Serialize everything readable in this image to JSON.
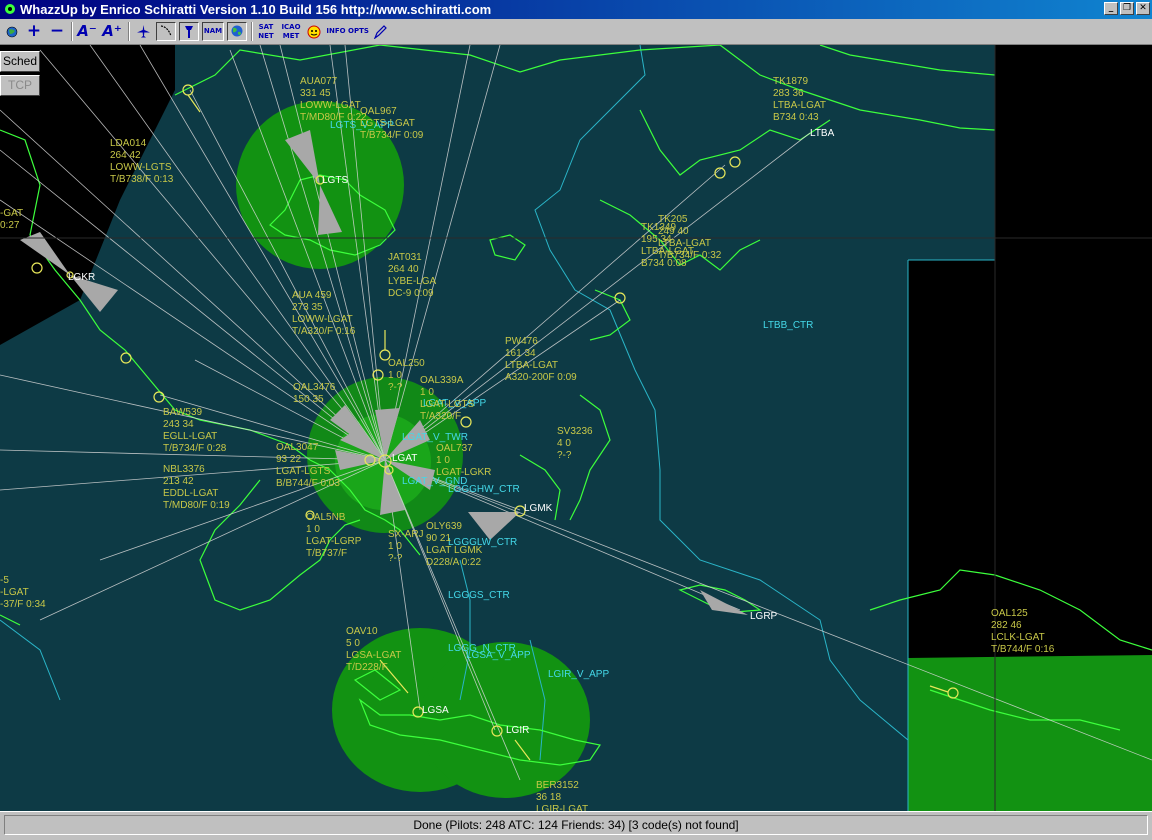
{
  "window": {
    "title": "WhazzUp by Enrico Schiratti Version 1.10 Build 156 http://www.schiratti.com"
  },
  "toolbar": {
    "buttons": [
      {
        "name": "globe-icon",
        "label": ""
      },
      {
        "name": "zoom-in-icon",
        "label": "+"
      },
      {
        "name": "zoom-out-icon",
        "label": "−"
      },
      {
        "name": "font-smaller-icon",
        "label": "A⁻"
      },
      {
        "name": "font-larger-icon",
        "label": "A⁺"
      },
      {
        "name": "aircraft-icon",
        "label": ""
      },
      {
        "name": "route-icon",
        "label": ""
      },
      {
        "name": "tower-icon",
        "label": ""
      },
      {
        "name": "nam-button",
        "label": "NAM"
      },
      {
        "name": "world-icon",
        "label": ""
      },
      {
        "name": "sat-net-button",
        "label": "SAT NET"
      },
      {
        "name": "icao-met-button",
        "label": "ICAO MET"
      },
      {
        "name": "friends-icon",
        "label": ""
      },
      {
        "name": "info-button",
        "label": "INFO"
      },
      {
        "name": "opts-button",
        "label": "OPTS"
      },
      {
        "name": "pen-icon",
        "label": ""
      }
    ]
  },
  "sidebar": {
    "sched": "Sched",
    "tcp": "TCP"
  },
  "map": {
    "colors": {
      "sea": "#0d3a45",
      "land_outside": "#000000",
      "coast": "#3cff3c",
      "fir": "#2ab5c8",
      "coverage": "#129212",
      "label_flight": "#c8c848",
      "label_atc": "#44d8e8",
      "label_airport": "#ffffff",
      "cone": "#a8a8a8"
    },
    "airports": [
      "LGTS",
      "LGKR",
      "LTBA",
      "LGAT",
      "LGMK",
      "LGRP",
      "LGSA",
      "LGIR"
    ],
    "atc_labels": [
      "LGTS_V_APP",
      "LTBB_CTR",
      "LGAT_V_APP",
      "LGAT_V_TWR",
      "LGAT_V_GND",
      "LGGGHW_CTR",
      "LGGGLW_CTR",
      "LGGGS_CTR",
      "LGGG_N_CTR",
      "LGSA_V_APP",
      "LGIR_V_APP"
    ],
    "flights": [
      {
        "lines": [
          "AUA077",
          "331 45",
          "LOWW-LGAT",
          "T/MD80/F 0:22"
        ]
      },
      {
        "lines": [
          "OAL967",
          "LGTS-LGAT",
          "T/B734/F 0:09"
        ]
      },
      {
        "lines": [
          "LDA014",
          "264 42",
          "LOWW-LGTS",
          "T/B738/F 0:13"
        ]
      },
      {
        "lines": [
          "TK1879",
          "283 36",
          "LTBA-LGAT",
          "B734 0:43"
        ]
      },
      {
        "lines": [
          "TK205",
          "249 40",
          "LTBA-LGAT",
          "T/B734/F 0:32"
        ]
      },
      {
        "lines": [
          "TK1349",
          "195 34",
          "LTBA-LGAT",
          "B734 0:08"
        ]
      },
      {
        "lines": [
          "JAT031",
          "264 40",
          "LYBE-LGA",
          "DC-9 0:09"
        ]
      },
      {
        "lines": [
          "AUA 459",
          "273 35",
          "LOWW-LGAT",
          "T/A320/F 0:16"
        ]
      },
      {
        "lines": [
          "OAL250",
          "1 0",
          "?-?"
        ]
      },
      {
        "lines": [
          "PW476",
          "161 34",
          "LTBA-LGAT",
          "A320-200F 0:09"
        ]
      },
      {
        "lines": [
          "OAL339A",
          "1 0",
          "LGAT-LGTS",
          "T/A320/F"
        ]
      },
      {
        "lines": [
          "OAL737",
          "1 0",
          "LGAT-LGKR"
        ]
      },
      {
        "lines": [
          "BAW539",
          "243 34",
          "EGLL-LGAT",
          "T/B734/F 0:28"
        ]
      },
      {
        "lines": [
          "OAL3476",
          "150 35"
        ]
      },
      {
        "lines": [
          "SV3236",
          "4 0",
          "?-?"
        ]
      },
      {
        "lines": [
          "OAL3047",
          "93 22",
          "LGAT-LGTS",
          "B/B744/F 0:03"
        ]
      },
      {
        "lines": [
          "NBL3376",
          "213 42",
          "EDDL-LGAT",
          "T/MD80/F 0:19"
        ]
      },
      {
        "lines": [
          "OLY639",
          "90 21",
          "LGAT LGMK",
          "D228/A 0:22"
        ]
      },
      {
        "lines": [
          "SX-ARJ",
          "1 0",
          "?-?"
        ]
      },
      {
        "lines": [
          "OAL5NB",
          "1 0",
          "LGAT-LGRP",
          "T/B737/F"
        ]
      },
      {
        "lines": [
          "OAV10",
          "5 0",
          "LGSA-LGAT",
          "T/D228/F"
        ]
      },
      {
        "lines": [
          "OAL125",
          "282 46",
          "LCLK-LGAT",
          "T/B744/F 0:16"
        ]
      },
      {
        "lines": [
          "BER3152",
          "36 18",
          "LGIR-LGAT"
        ]
      },
      {
        "lines": [
          "-GAT",
          "0:27"
        ]
      },
      {
        "lines": [
          "-5",
          "-LGAT",
          "-37/F 0:34"
        ]
      }
    ]
  },
  "status": {
    "text": "Done (Pilots: 248  ATC: 124  Friends: 34) [3 code(s) not found]"
  }
}
